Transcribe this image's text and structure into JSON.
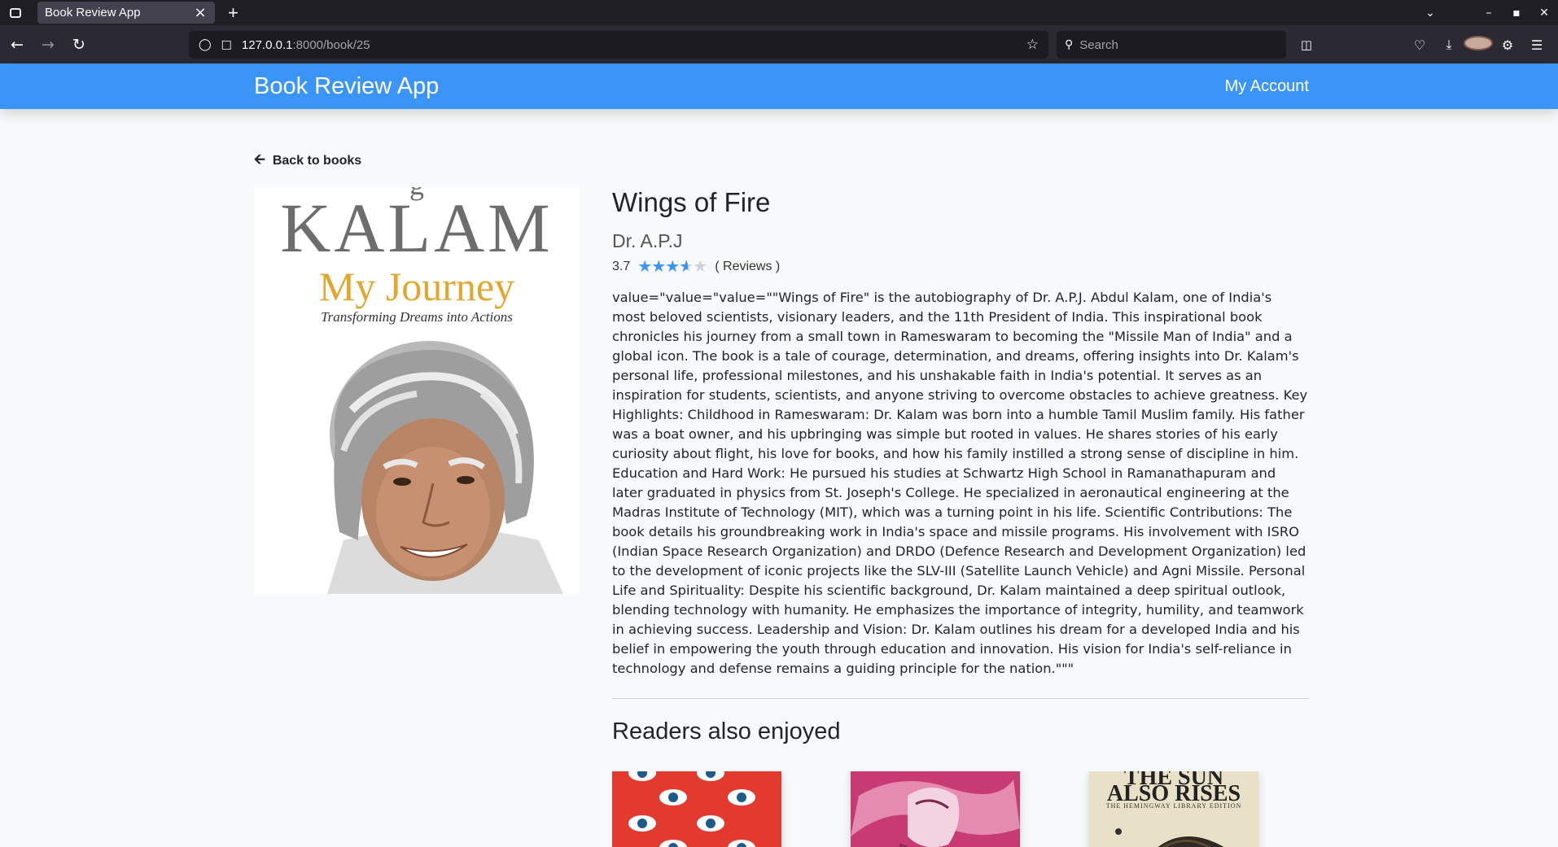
{
  "browser": {
    "tab_title": "Book Review App",
    "tab_close": "×",
    "new_tab": "+",
    "url_host": "127.0.0.1",
    "url_rest": ":8000/book/25",
    "search_placeholder": "Search"
  },
  "app": {
    "brand": "Book Review App",
    "account_link": "My Account"
  },
  "back_link": "Back to books",
  "cover": {
    "top_text": "g",
    "name": "KALAM",
    "subtitle": "My Journey",
    "tagline": "Transforming Dreams into Actions"
  },
  "book": {
    "title": "Wings of Fire",
    "author": "Dr. A.P.J",
    "rating": "3.7",
    "rating_value": 3.7,
    "rating_max": 5,
    "reviews_label": "( Reviews )",
    "description": "value=\"value=\"value=\"\"Wings of Fire\" is the autobiography of Dr. A.P.J. Abdul Kalam, one of India's most beloved scientists, visionary leaders, and the 11th President of India. This inspirational book chronicles his journey from a small town in Rameswaram to becoming the \"Missile Man of India\" and a global icon. The book is a tale of courage, determination, and dreams, offering insights into Dr. Kalam's personal life, professional milestones, and his unshakable faith in India's potential. It serves as an inspiration for students, scientists, and anyone striving to overcome obstacles to achieve greatness. Key Highlights: Childhood in Rameswaram: Dr. Kalam was born into a humble Tamil Muslim family. His father was a boat owner, and his upbringing was simple but rooted in values. He shares stories of his early curiosity about flight, his love for books, and how his family instilled a strong sense of discipline in him. Education and Hard Work: He pursued his studies at Schwartz High School in Ramanathapuram and later graduated in physics from St. Joseph's College. He specialized in aeronautical engineering at the Madras Institute of Technology (MIT), which was a turning point in his life. Scientific Contributions: The book details his groundbreaking work in India's space and missile programs. His involvement with ISRO (Indian Space Research Organization) and DRDO (Defence Research and Development Organization) led to the development of iconic projects like the SLV-III (Satellite Launch Vehicle) and Agni Missile. Personal Life and Spirituality: Despite his scientific background, Dr. Kalam maintained a deep spiritual outlook, blending technology with humanity. He emphasizes the importance of integrity, humility, and teamwork in achieving success. Leadership and Vision: Dr. Kalam outlines his dream for a developed India and his belief in empowering the youth through education and innovation. His vision for India's self-reliance in technology and defense remains a guiding principle for the nation.\"\"\""
  },
  "related": {
    "heading": "Readers also enjoyed",
    "card3_title": "THE SUN\nALSO RISES",
    "card3_edition": "THE HEMINGWAY LIBRARY EDITION"
  },
  "colors": {
    "accent": "#3b94f7",
    "star_empty": "#d0d0d0"
  }
}
